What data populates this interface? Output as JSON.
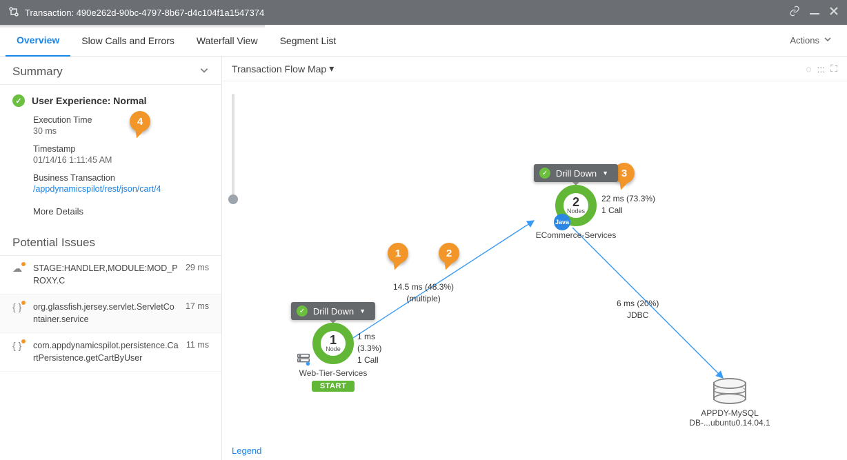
{
  "titlebar": {
    "prefix": "Transaction:",
    "id": "490e262d-90bc-4797-8b67-d4c104f1a1547374"
  },
  "tabs": {
    "items": [
      "Overview",
      "Slow Calls and Errors",
      "Waterfall View",
      "Segment List"
    ],
    "active": 0,
    "actions_label": "Actions"
  },
  "summary": {
    "title": "Summary",
    "user_experience_label": "User Experience:",
    "user_experience_value": "Normal",
    "exec_time_label": "Execution Time",
    "exec_time_value": "30 ms",
    "timestamp_label": "Timestamp",
    "timestamp_value": "01/14/16 1:11:45 AM",
    "bt_label": "Business Transaction",
    "bt_link": "/appdynamicspilot/rest/json/cart/4",
    "more_details": "More Details"
  },
  "potential_issues": {
    "title": "Potential Issues",
    "items": [
      {
        "icon": "cloud",
        "name": "STAGE:HANDLER,MODULE:MOD_PROXY.C",
        "time": "29 ms"
      },
      {
        "icon": "code",
        "name": "org.glassfish.jersey.servlet.ServletContainer.service",
        "time": "17 ms"
      },
      {
        "icon": "code",
        "name": "com.appdynamicspilot.persistence.CartPersistence.getCartByUser",
        "time": "11 ms"
      }
    ]
  },
  "map": {
    "title": "Transaction Flow Map",
    "legend": "Legend",
    "nodes": {
      "web": {
        "drill": "Drill Down",
        "count": "1",
        "count_label": "Node",
        "label": "Web-Tier-Services",
        "start": "START",
        "stats_line1": "1 ms (3.3%)",
        "stats_line2": "1 Call"
      },
      "ecom": {
        "drill": "Drill Down",
        "count": "2",
        "count_label": "Nodes",
        "label": "ECommerce-Services",
        "java": "Java",
        "stats_line1": "22 ms (73.3%)",
        "stats_line2": "1 Call"
      },
      "db": {
        "label": "APPDY-MySQL DB-...ubuntu0.14.04.1"
      }
    },
    "edges": {
      "web_ecom": {
        "line1": "14.5 ms (48.3%)",
        "line2": "(multiple)"
      },
      "ecom_db": {
        "line1": "6 ms (20%)",
        "line2": "JDBC"
      }
    },
    "callouts": [
      "1",
      "2",
      "3",
      "4"
    ]
  }
}
